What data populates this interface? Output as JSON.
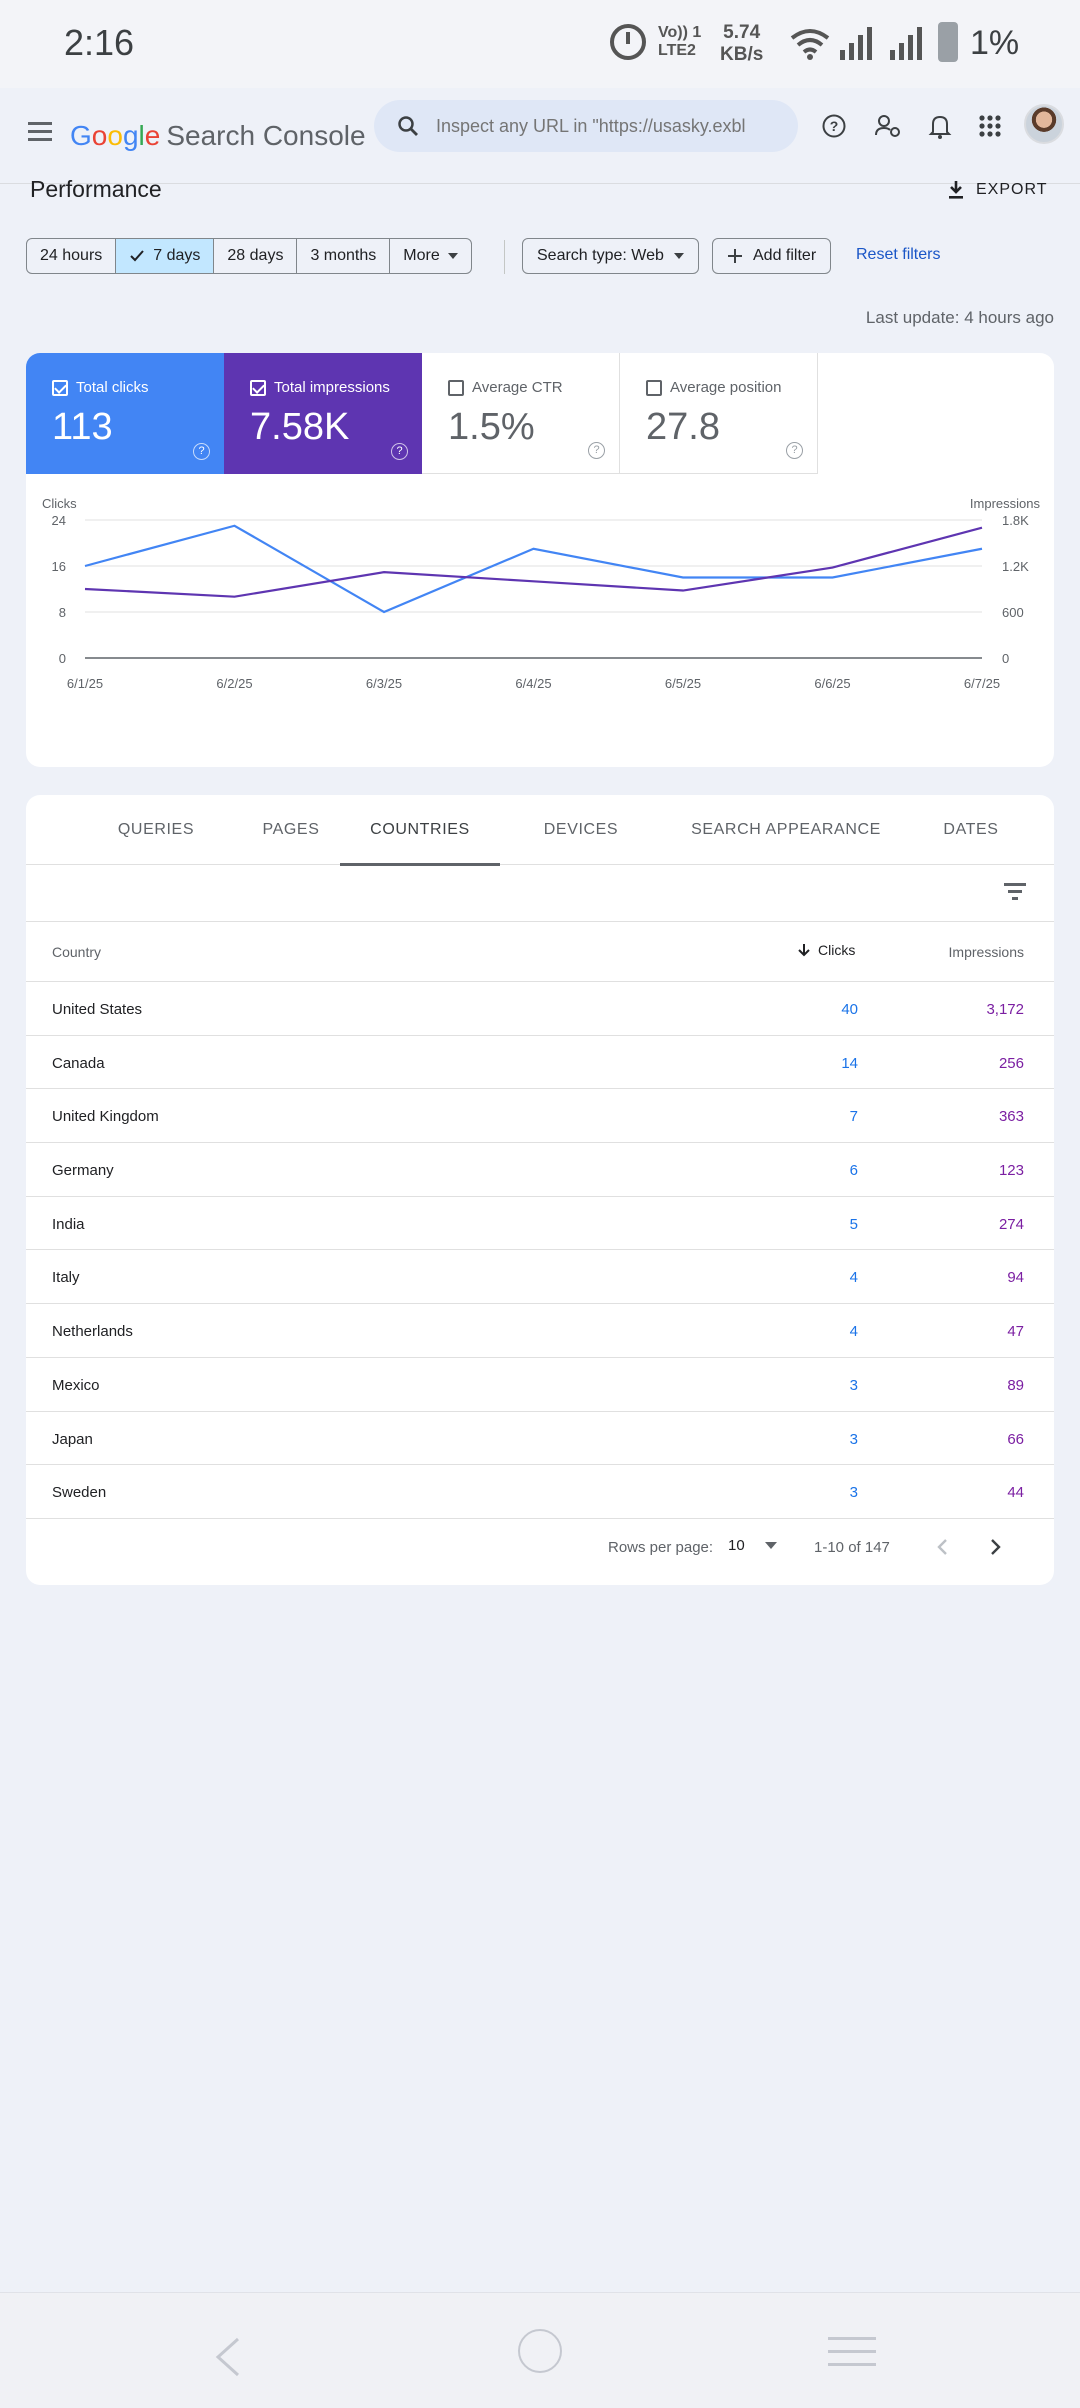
{
  "status_bar": {
    "time": "2:16",
    "volte_line1": "Vo)) 1",
    "volte_line2": "LTE2",
    "speed_value": "5.74",
    "speed_unit": "KB/s",
    "battery": "1%"
  },
  "header": {
    "logo_letters": [
      "G",
      "o",
      "o",
      "g",
      "l",
      "e"
    ],
    "product": "Search Console",
    "search_placeholder": "Inspect any URL in \"https://usasky.exbl"
  },
  "page": {
    "title": "Performance",
    "export_label": "EXPORT"
  },
  "filters": {
    "ranges": [
      "24 hours",
      "7 days",
      "28 days",
      "3 months",
      "More"
    ],
    "active_range": "7 days",
    "search_type": "Search type: Web",
    "add_filter": "Add filter",
    "reset": "Reset filters",
    "last_update": "Last update: 4 hours ago"
  },
  "metrics": [
    {
      "label": "Total clicks",
      "value": "113",
      "checked": true
    },
    {
      "label": "Total impressions",
      "value": "7.58K",
      "checked": true
    },
    {
      "label": "Average CTR",
      "value": "1.5%",
      "checked": false
    },
    {
      "label": "Average position",
      "value": "27.8",
      "checked": false
    }
  ],
  "colors": {
    "clicks": "#4285f4",
    "impressions": "#5e35b1",
    "link": "#1a56c7"
  },
  "chart_data": {
    "type": "line",
    "x": [
      "6/1/25",
      "6/2/25",
      "6/3/25",
      "6/4/25",
      "6/5/25",
      "6/6/25",
      "6/7/25"
    ],
    "y_left_label": "Clicks",
    "y_right_label": "Impressions",
    "y_left_ticks": [
      "24",
      "16",
      "8",
      "0"
    ],
    "y_right_ticks": [
      "1.8K",
      "1.2K",
      "600",
      "0"
    ],
    "y_left_range": [
      0,
      24
    ],
    "y_right_range": [
      0,
      1800
    ],
    "grid": true,
    "series": [
      {
        "name": "Clicks",
        "axis": "left",
        "color": "#4285f4",
        "values": [
          16,
          23,
          8,
          19,
          14,
          14,
          19
        ]
      },
      {
        "name": "Impressions",
        "axis": "right",
        "color": "#5e35b1",
        "values": [
          900,
          800,
          1120,
          1000,
          880,
          1180,
          1700
        ]
      }
    ]
  },
  "table": {
    "tabs": [
      "QUERIES",
      "PAGES",
      "COUNTRIES",
      "DEVICES",
      "SEARCH APPEARANCE",
      "DATES"
    ],
    "active_tab": "COUNTRIES",
    "columns": {
      "country": "Country",
      "clicks": "Clicks",
      "impressions": "Impressions"
    },
    "rows": [
      {
        "country": "United States",
        "clicks": "40",
        "impressions": "3,172"
      },
      {
        "country": "Canada",
        "clicks": "14",
        "impressions": "256"
      },
      {
        "country": "United Kingdom",
        "clicks": "7",
        "impressions": "363"
      },
      {
        "country": "Germany",
        "clicks": "6",
        "impressions": "123"
      },
      {
        "country": "India",
        "clicks": "5",
        "impressions": "274"
      },
      {
        "country": "Italy",
        "clicks": "4",
        "impressions": "94"
      },
      {
        "country": "Netherlands",
        "clicks": "4",
        "impressions": "47"
      },
      {
        "country": "Mexico",
        "clicks": "3",
        "impressions": "89"
      },
      {
        "country": "Japan",
        "clicks": "3",
        "impressions": "66"
      },
      {
        "country": "Sweden",
        "clicks": "3",
        "impressions": "44"
      }
    ],
    "pagination": {
      "rows_per_page_label": "Rows per page:",
      "rows_per_page": "10",
      "range": "1-10 of 147"
    }
  },
  "icons": [
    "alarm-icon",
    "wifi-icon",
    "signal-icon",
    "battery-icon",
    "menu-icon",
    "search-icon",
    "help-icon",
    "manage-accounts-icon",
    "bell-icon",
    "apps-icon",
    "download-icon",
    "check-icon",
    "dropdown-icon",
    "plus-icon",
    "filter-icon",
    "arrow-down-icon",
    "chevron-left-icon",
    "chevron-right-icon"
  ]
}
